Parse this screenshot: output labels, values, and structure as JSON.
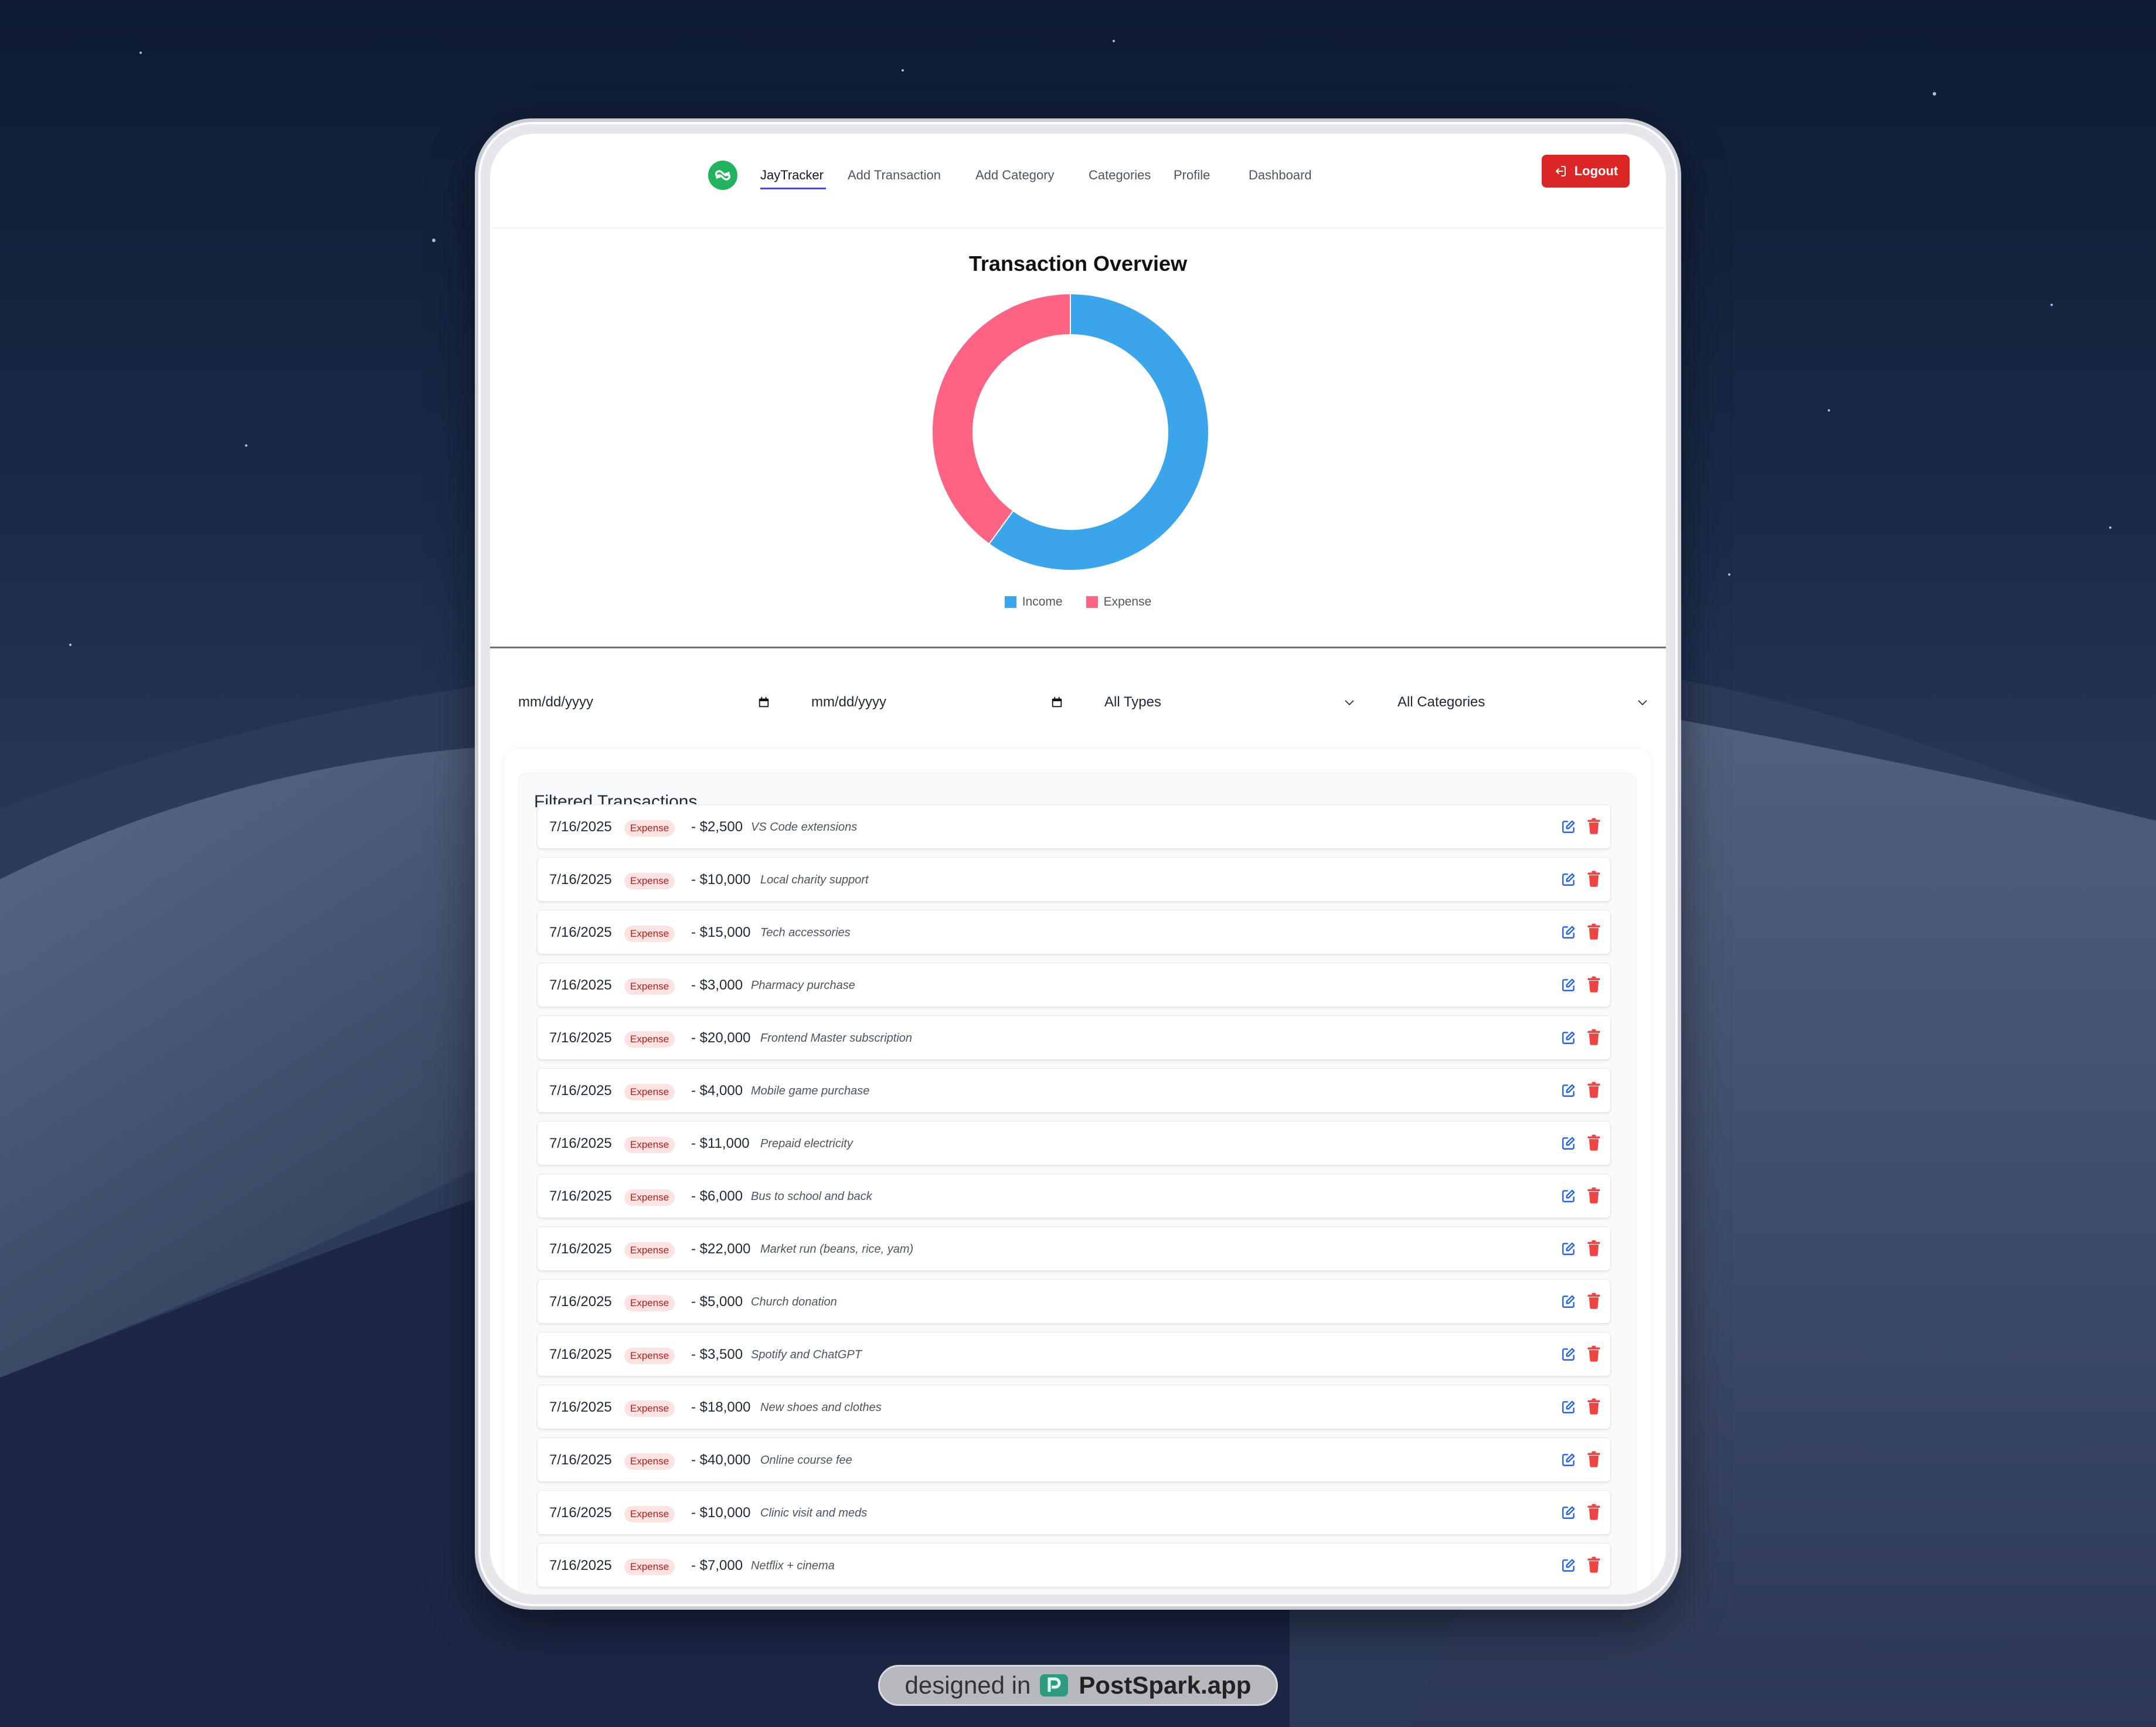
{
  "nav": {
    "brand": "JayTracker",
    "items": [
      "Add Transaction",
      "Add Category",
      "Categories",
      "Profile",
      "Dashboard"
    ],
    "logout_label": "Logout"
  },
  "overview": {
    "title": "Transaction Overview"
  },
  "chart_data": {
    "type": "pie",
    "labels": [
      "Income",
      "Expense"
    ],
    "values": [
      60,
      40
    ],
    "colors": [
      "#3aa5eb",
      "#ff6384"
    ],
    "legend_position": "bottom"
  },
  "filters": {
    "start_date_placeholder": "mm/dd/yyyy",
    "end_date_placeholder": "mm/dd/yyyy",
    "type_value": "All Types",
    "category_value": "All Categories"
  },
  "transactions": {
    "title": "Filtered Transactions",
    "rows": [
      {
        "date": "7/16/2025",
        "type": "Expense",
        "amount": "- $2,500",
        "description": "VS Code extensions"
      },
      {
        "date": "7/16/2025",
        "type": "Expense",
        "amount": "- $10,000",
        "description": "Local charity support"
      },
      {
        "date": "7/16/2025",
        "type": "Expense",
        "amount": "- $15,000",
        "description": "Tech accessories"
      },
      {
        "date": "7/16/2025",
        "type": "Expense",
        "amount": "- $3,000",
        "description": "Pharmacy purchase"
      },
      {
        "date": "7/16/2025",
        "type": "Expense",
        "amount": "- $20,000",
        "description": "Frontend Master subscription"
      },
      {
        "date": "7/16/2025",
        "type": "Expense",
        "amount": "- $4,000",
        "description": "Mobile game purchase"
      },
      {
        "date": "7/16/2025",
        "type": "Expense",
        "amount": "- $11,000",
        "description": "Prepaid electricity"
      },
      {
        "date": "7/16/2025",
        "type": "Expense",
        "amount": "- $6,000",
        "description": "Bus to school and back"
      },
      {
        "date": "7/16/2025",
        "type": "Expense",
        "amount": "- $22,000",
        "description": "Market run (beans, rice, yam)"
      },
      {
        "date": "7/16/2025",
        "type": "Expense",
        "amount": "- $5,000",
        "description": "Church donation"
      },
      {
        "date": "7/16/2025",
        "type": "Expense",
        "amount": "- $3,500",
        "description": "Spotify and ChatGPT"
      },
      {
        "date": "7/16/2025",
        "type": "Expense",
        "amount": "- $18,000",
        "description": "New shoes and clothes"
      },
      {
        "date": "7/16/2025",
        "type": "Expense",
        "amount": "- $40,000",
        "description": "Online course fee"
      },
      {
        "date": "7/16/2025",
        "type": "Expense",
        "amount": "- $10,000",
        "description": "Clinic visit and meds"
      },
      {
        "date": "7/16/2025",
        "type": "Expense",
        "amount": "- $7,000",
        "description": "Netflix + cinema"
      }
    ]
  },
  "footer": {
    "prefix": "designed in",
    "brand": "PostSpark.app"
  },
  "icons": {
    "logo": "link-logo-icon",
    "logout": "logout-icon",
    "calendar": "calendar-icon",
    "chevron": "chevron-down-icon",
    "edit": "edit-icon",
    "delete": "trash-icon"
  },
  "colors": {
    "accent": "#4f46e5",
    "logout": "#dc2626",
    "income": "#3aa5eb",
    "expense": "#ff6384",
    "edit_icon": "#2563eb",
    "delete_icon": "#ef4444"
  }
}
